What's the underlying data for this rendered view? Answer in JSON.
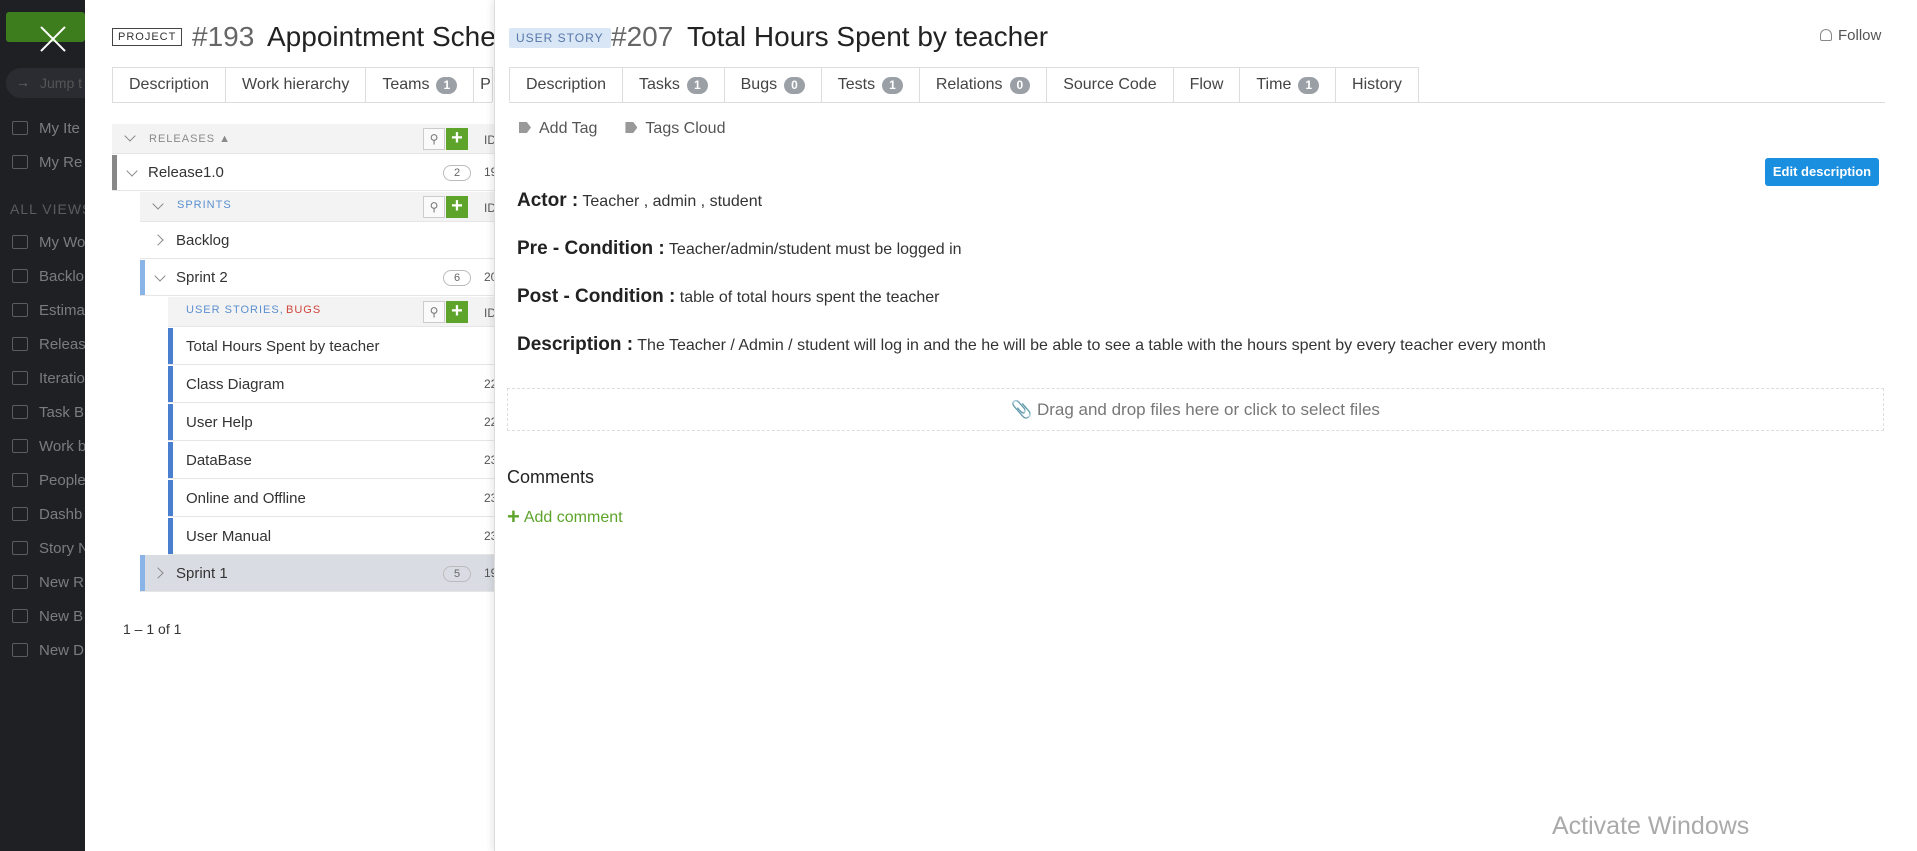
{
  "app_sidebar": {
    "jump_placeholder": "Jump t",
    "items_top": [
      "My Ite",
      "My Re"
    ],
    "section_label": "ALL VIEWS",
    "items": [
      "My Wo",
      "Backlo",
      "Estima",
      "Releas",
      "Iteratio",
      "Task B",
      "Work b",
      "People",
      "Dashb",
      "Story N",
      "New R",
      "New B",
      "New D"
    ]
  },
  "project": {
    "badge": "PROJECT",
    "id": "#193",
    "title": "Appointment Sched",
    "tabs": [
      {
        "label": "Description"
      },
      {
        "label": "Work hierarchy"
      },
      {
        "label": "Teams",
        "count": "1"
      },
      {
        "label": "P"
      }
    ]
  },
  "tree": {
    "releases_header": "RELEASES ▲",
    "id_col": "ID",
    "release": {
      "label": "Release1.0",
      "count": "2",
      "id": "19"
    },
    "sprints_header": "SPRINTS",
    "backlog": "Backlog",
    "sprint2": {
      "label": "Sprint 2",
      "count": "6",
      "id": "20"
    },
    "stories_header_a": "USER STORIES,",
    "stories_header_b": "BUGS",
    "stories": [
      {
        "label": "Total Hours Spent by teacher",
        "id": ""
      },
      {
        "label": "Class Diagram",
        "id": "22"
      },
      {
        "label": "User Help",
        "id": "22"
      },
      {
        "label": "DataBase",
        "id": "23"
      },
      {
        "label": "Online and Offline",
        "id": "23"
      },
      {
        "label": "User Manual",
        "id": "23"
      }
    ],
    "sprint1": {
      "label": "Sprint 1",
      "count": "5",
      "id": "19"
    },
    "pager": "1 – 1 of 1"
  },
  "story": {
    "badge": "USER STORY",
    "id": "#207",
    "title": "Total Hours Spent by teacher",
    "follow": "Follow",
    "tabs": [
      {
        "label": "Description"
      },
      {
        "label": "Tasks",
        "count": "1"
      },
      {
        "label": "Bugs",
        "count": "0"
      },
      {
        "label": "Tests",
        "count": "1"
      },
      {
        "label": "Relations",
        "count": "0"
      },
      {
        "label": "Source Code"
      },
      {
        "label": "Flow"
      },
      {
        "label": "Time",
        "count": "1"
      },
      {
        "label": "History"
      }
    ],
    "add_tag": "Add Tag",
    "tags_cloud": "Tags Cloud",
    "edit_description": "Edit description",
    "description": [
      {
        "label": "Actor :",
        "text": " Teacher , admin , student"
      },
      {
        "label": "Pre - Condition :",
        "text": " Teacher/admin/student must be logged in"
      },
      {
        "label": "Post - Condition :",
        "text": " table of total hours spent the teacher"
      },
      {
        "label": "Description :",
        "text": " The Teacher / Admin / student will log in and the he will be able to see a table with the hours spent by every teacher  every month"
      }
    ],
    "dropzone": "Drag and drop files here or click to select files",
    "comments_title": "Comments",
    "add_comment": "Add comment"
  },
  "watermark": "Activate Windows",
  "colors": {
    "accent_blue": "#1a8fe0",
    "accent_green": "#5ea42b",
    "sidebar_dark": "#1f2024"
  }
}
